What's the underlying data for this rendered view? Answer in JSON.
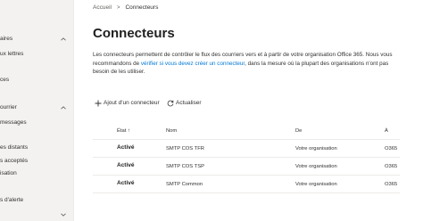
{
  "sidebar": {
    "items": [
      {
        "label": "aires",
        "chevron": "chevron-up"
      },
      {
        "label": "ux lettres",
        "chevron": ""
      },
      {
        "label": "ces",
        "chevron": ""
      },
      {
        "label": "ourrier",
        "chevron": "chevron-up"
      },
      {
        "label": "messages",
        "chevron": ""
      },
      {
        "label": "es distants",
        "chevron": ""
      },
      {
        "label": "s acceptés",
        "chevron": ""
      },
      {
        "label": "isation",
        "chevron": ""
      },
      {
        "label": "s d'alerte",
        "chevron": ""
      },
      {
        "label": "",
        "chevron": "chevron-down"
      }
    ]
  },
  "breadcrumb": {
    "root": "Accueil",
    "separator": ">",
    "current": "Connecteurs"
  },
  "page": {
    "title": "Connecteurs",
    "description_part1": "Les connecteurs permettent de contrôler le flux des courriers vers et à partir de votre organisation Office 365. Nous vous recommandons de ",
    "description_link": "vérifier si vous devez créer un connecteur",
    "description_part2": ", dans la mesure où la plupart des organisations n'ont pas besoin de les utiliser."
  },
  "toolbar": {
    "add_label": "Ajout d'un connecteur",
    "refresh_label": "Actualiser"
  },
  "table": {
    "headers": {
      "status": "État",
      "name": "Nom",
      "from": "De",
      "to": "À",
      "sort_indicator": "↑"
    },
    "rows": [
      {
        "status": "Activé",
        "name": "SMTP COS TFR",
        "from": "Votre organisation",
        "to": "O365"
      },
      {
        "status": "Activé",
        "name": "SMTP COS TSP",
        "from": "Votre organisation",
        "to": "O365"
      },
      {
        "status": "Activé",
        "name": "SMTP Common",
        "from": "Votre organisation",
        "to": "O365"
      }
    ]
  },
  "colors": {
    "accent": "#0078d4",
    "sidebar_bg": "#f3f2f1",
    "text": "#323130"
  }
}
